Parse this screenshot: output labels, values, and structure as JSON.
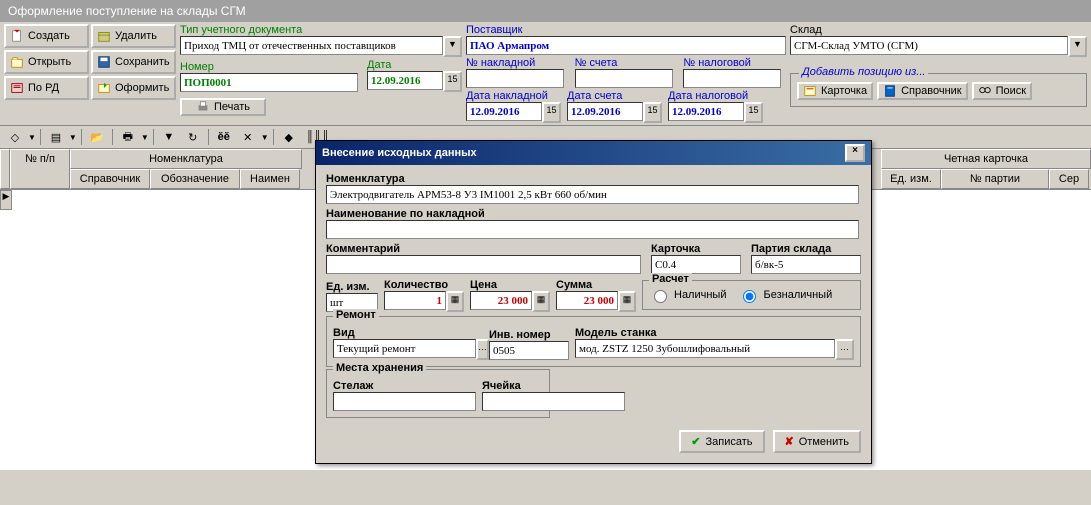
{
  "title": "Оформление поступление на склады СГМ",
  "buttons": {
    "create": "Создать",
    "delete": "Удалить",
    "open": "Открыть",
    "save": "Сохранить",
    "byrd": "По РД",
    "process": "Оформить",
    "print": "Печать"
  },
  "doc": {
    "type_lbl": "Тип учетного документа",
    "type_val": "Приход ТМЦ от отечественных поставщиков",
    "num_lbl": "Номер",
    "num_val": "ПОП0001",
    "date_lbl": "Дата",
    "date_val": "12.09.2016"
  },
  "supplier": {
    "lbl": "Поставщик",
    "val": "ПАО Армапром"
  },
  "invoice": {
    "num_lbl": "№ накладной",
    "acc_lbl": "№ счета",
    "tax_lbl": "№ налоговой",
    "date_inv_lbl": "Дата накладной",
    "date_acc_lbl": "Дата счета",
    "date_tax_lbl": "Дата налоговой",
    "date_val": "12.09.2016"
  },
  "sklad": {
    "lbl": "Склад",
    "val": "СГМ-Склад УМТО (СГМ)",
    "add_lbl": "Добавить позицию из...",
    "card": "Карточка",
    "ref": "Справочник",
    "search": "Поиск"
  },
  "grid": {
    "npp": "№ п/п",
    "nomen": "Номенклатура",
    "spr": "Справочник",
    "obz": "Обозначение",
    "naim": "Наимен",
    "uk": "Четная карточка",
    "ed": "Ед. изм.",
    "part": "№ партии",
    "ser": "Сер"
  },
  "modal": {
    "title": "Внесение исходных данных",
    "nomen_lbl": "Номенклатура",
    "nomen_val": "Электродвигатель АРМ53-8 У3 IМ1001 2,5 кВт 660 об/мин",
    "name_inv_lbl": "Наименование по накладной",
    "name_inv_val": "",
    "comment_lbl": "Комментарий",
    "comment_val": "",
    "card_lbl": "Карточка",
    "card_val": "С0.4",
    "party_lbl": "Партия склада",
    "party_val": "б/вк-5",
    "ed_lbl": "Ед. изм.",
    "ed_val": "шт",
    "qty_lbl": "Количество",
    "qty_val": "1",
    "price_lbl": "Цена",
    "price_val": "23 000",
    "sum_lbl": "Сумма",
    "sum_val": "23 000",
    "calc_lbl": "Расчет",
    "cash": "Наличный",
    "noncash": "Безналичный",
    "repair_lbl": "Ремонт",
    "kind_lbl": "Вид",
    "kind_val": "Текущий ремонт",
    "inv_lbl": "Инв. номер",
    "inv_val": "0505",
    "model_lbl": "Модель станка",
    "model_val": "мод. ZSTZ 1250 Зубошлифовальный",
    "storage_lbl": "Места хранения",
    "shelf_lbl": "Стелаж",
    "cell_lbl": "Ячейка",
    "save": "Записать",
    "cancel": "Отменить"
  }
}
